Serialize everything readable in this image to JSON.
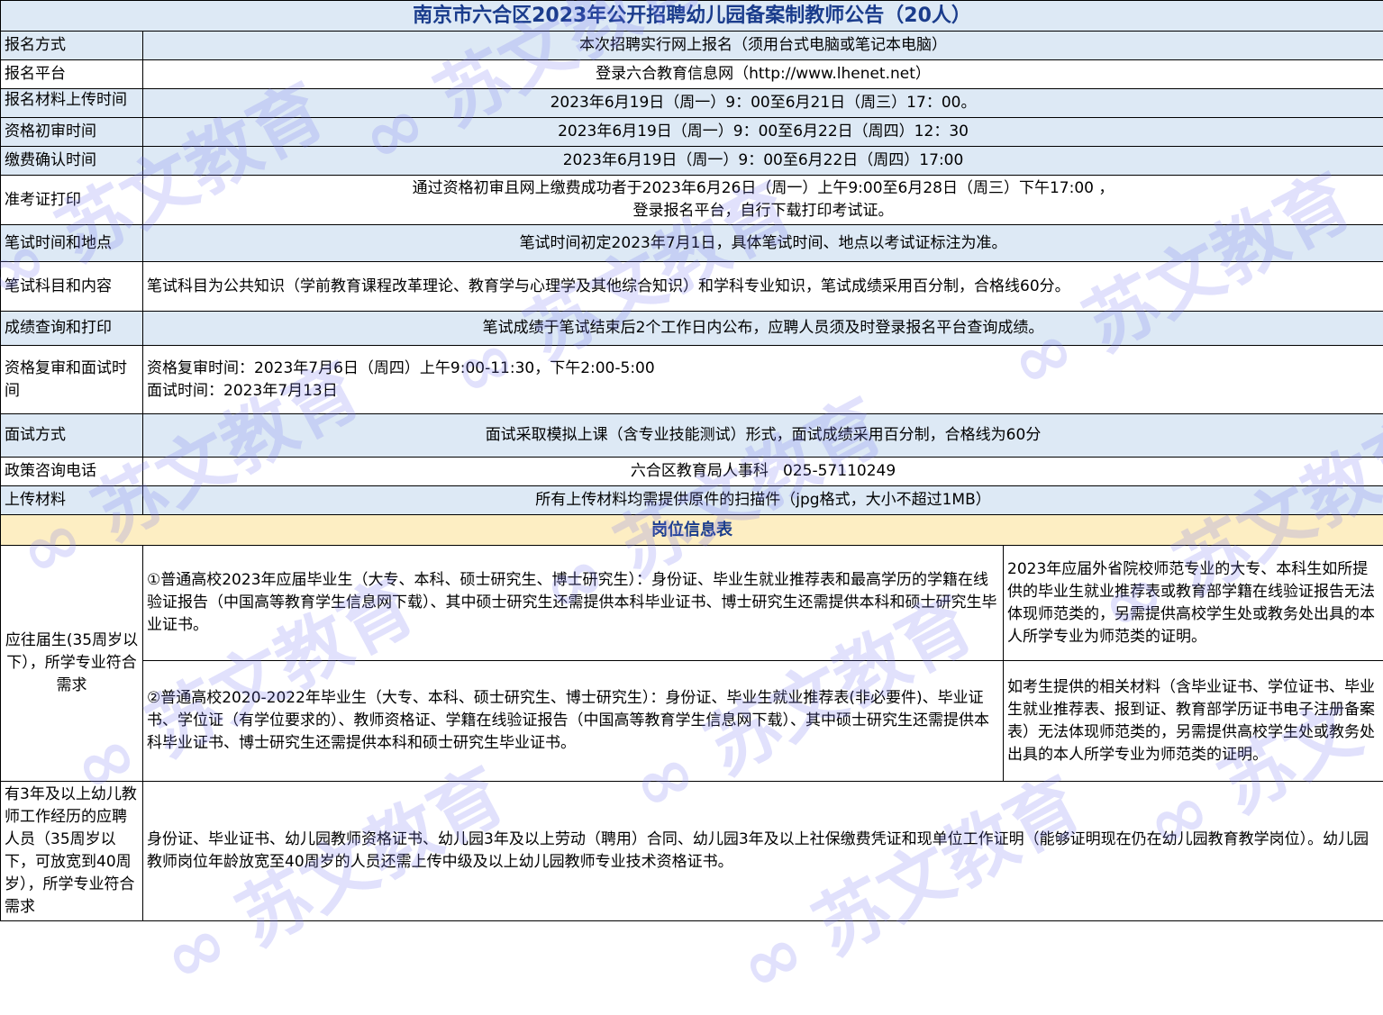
{
  "title": "南京市六合区2023年公开招聘幼儿园备案制教师公告（20人）",
  "rows": [
    {
      "label": "报名方式",
      "value": "本次招聘实行网上报名（须用台式电脑或笔记本电脑）"
    },
    {
      "label": "报名平台",
      "value": "登录六合教育信息网（http://www.lhenet.net）"
    },
    {
      "label": "报名材料上传时间",
      "value": "2023年6月19日（周一）9：00至6月21日（周三）17：00。"
    },
    {
      "label": "资格初审时间",
      "value": "2023年6月19日（周一）9：00至6月22日（周四）12：30"
    },
    {
      "label": "缴费确认时间",
      "value": "2023年6月19日（周一）9：00至6月22日（周四）17:00"
    },
    {
      "label": "准考证打印",
      "value_line1": "通过资格初审且网上缴费成功者于2023年6月26日（周一）上午9:00至6月28日（周三）下午17:00 ，",
      "value_line2": "登录报名平台，自行下载打印考试证。"
    },
    {
      "label": "笔试时间和地点",
      "value": "笔试时间初定2023年7月1日，具体笔试时间、地点以考试证标注为准。"
    },
    {
      "label": "笔试科目和内容",
      "value": "笔试科目为公共知识（学前教育课程改革理论、教育学与心理学及其他综合知识）和学科专业知识，笔试成绩采用百分制，合格线60分。"
    },
    {
      "label": "成绩查询和打印",
      "value": "笔试成绩于笔试结束后2个工作日内公布，应聘人员须及时登录报名平台查询成绩。"
    },
    {
      "label": "资格复审和面试时间",
      "value_line1": "资格复审时间：2023年7月6日（周四）上午9:00-11:30，下午2:00-5:00",
      "value_line2": "面试时间：2023年7月13日"
    },
    {
      "label": "面试方式",
      "value": "面试采取模拟上课（含专业技能测试）形式，面试成绩采用百分制，合格线为60分"
    },
    {
      "label": "政策咨询电话",
      "value": "六合区教育局人事科   025-57110249"
    },
    {
      "label": "上传材料",
      "value": "所有上传材料均需提供原件的扫描件（jpg格式，大小不超过1MB）"
    }
  ],
  "section_title": "岗位信息表",
  "group1": {
    "label": "应往届生(35周岁以下），所学专业符合需求",
    "item1": "①普通高校2023年应届毕业生（大专、本科、硕士研究生、博士研究生）：身份证、毕业生就业推荐表和最高学历的学籍在线验证报告（中国高等教育学生信息网下载）、其中硕士研究生还需提供本科毕业证书、博士研究生还需提供本科和硕士研究生毕业证书。",
    "note1": "2023年应届外省院校师范专业的大专、本科生如所提供的毕业生就业推荐表或教育部学籍在线验证报告无法体现师范类的，另需提供高校学生处或教务处出具的本人所学专业为师范类的证明。",
    "item2": "②普通高校2020-2022年毕业生（大专、本科、硕士研究生、博士研究生）：身份证、毕业生就业推荐表(非必要件)、毕业证书、学位证（有学位要求的）、教师资格证、学籍在线验证报告（中国高等教育学生信息网下载）、其中硕士研究生还需提供本科毕业证书、博士研究生还需提供本科和硕士研究生毕业证书。",
    "note2": "如考生提供的相关材料（含毕业证书、学位证书、毕业生就业推荐表、报到证、教育部学历证书电子注册备案表）无法体现师范类的，另需提供高校学生处或教务处出具的本人所学专业为师范类的证明。"
  },
  "group2": {
    "label": "有3年及以上幼儿教师工作经历的应聘人员（35周岁以下，可放宽到40周岁），所学专业符合需求",
    "value": "身份证、毕业证书、幼儿园教师资格证书、幼儿园3年及以上劳动（聘用）合同、幼儿园3年及以上社保缴费凭证和现单位工作证明（能够证明现在仍在幼儿园教育教学岗位）。幼儿园教师岗位年龄放宽至40周岁的人员还需上传中级及以上幼儿园教师专业技术资格证书。"
  }
}
